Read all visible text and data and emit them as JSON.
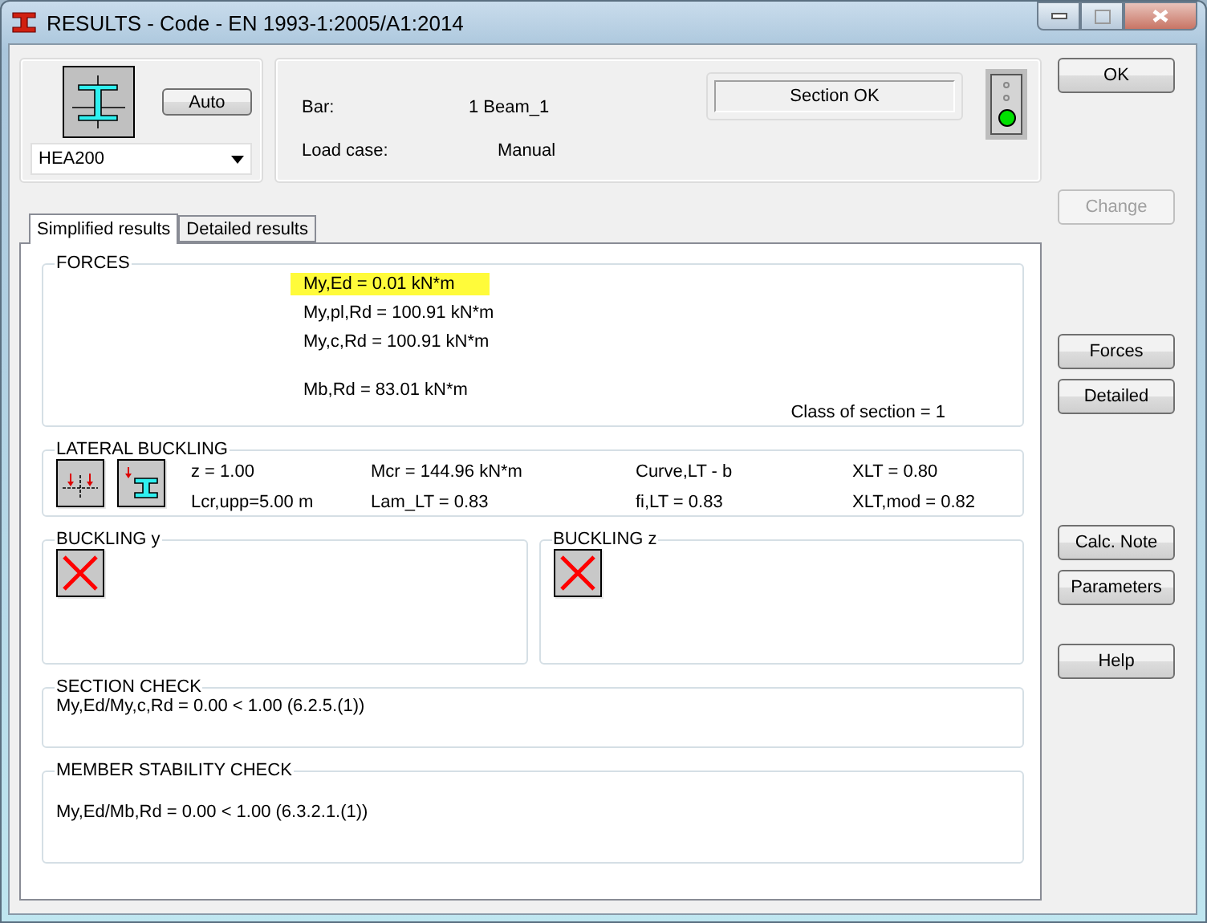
{
  "window": {
    "title": "RESULTS - Code - EN 1993-1:2005/A1:2014"
  },
  "section": {
    "auto_button": "Auto",
    "profile": "HEA200"
  },
  "info": {
    "bar_label": "Bar:",
    "bar_value": "1  Beam_1",
    "load_case_label": "Load case:",
    "load_case_value": "Manual",
    "status": "Section OK",
    "section_ok": true
  },
  "tabs": [
    {
      "label": "Simplified results",
      "selected": true
    },
    {
      "label": "Detailed results",
      "selected": false
    }
  ],
  "forces": {
    "title": "FORCES",
    "resistance_lines": [
      {
        "text": "My,Ed = 0.01 kN*m",
        "highlighted": true
      },
      {
        "text": "My,pl,Rd = 100.91 kN*m",
        "highlighted": false
      },
      {
        "text": "My,c,Rd = 100.91 kN*m",
        "highlighted": false
      }
    ],
    "buckling_lines": [
      {
        "text": "Mb,Rd = 83.01 kN*m",
        "highlighted": false
      }
    ],
    "class": "Class of section = 1"
  },
  "lateral_buckling": {
    "title": "LATERAL BUCKLING",
    "rows": [
      [
        "z = 1.00",
        "Mcr = 144.96 kN*m",
        "Curve,LT - b",
        "XLT = 0.80"
      ],
      [
        "Lcr,upp=5.00 m",
        "Lam_LT = 0.83",
        "fi,LT = 0.83",
        "XLT,mod = 0.82"
      ]
    ]
  },
  "buckling": [
    {
      "title": "BUCKLING y"
    },
    {
      "title": "BUCKLING z"
    }
  ],
  "section_check": {
    "title": "SECTION CHECK",
    "text": "My,Ed/My,c,Rd = 0.00 < 1.00   (6.2.5.(1))"
  },
  "member_stability_check": {
    "title": "MEMBER STABILITY CHECK",
    "text": "My,Ed/Mb,Rd = 0.00 < 1.00   (6.3.2.1.(1))"
  },
  "buttons": [
    {
      "label": "OK",
      "disabled": false
    },
    {
      "label": "Change",
      "disabled": true
    },
    {
      "label": "Forces",
      "disabled": false
    },
    {
      "label": "Detailed",
      "disabled": false
    },
    {
      "label": "Calc. Note",
      "disabled": false
    },
    {
      "label": "Parameters",
      "disabled": false
    },
    {
      "label": "Help",
      "disabled": false
    }
  ]
}
